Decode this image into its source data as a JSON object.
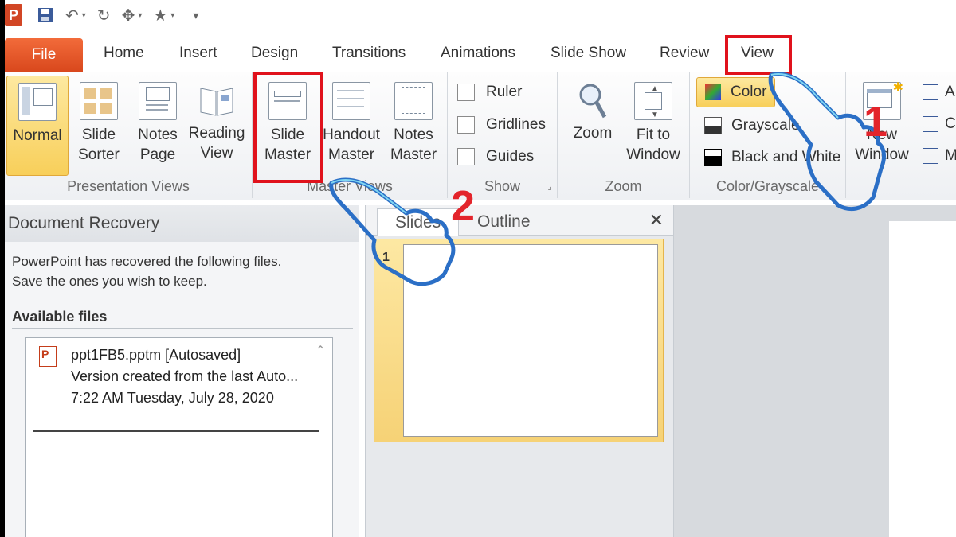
{
  "quick_access": {
    "app_logo": "P",
    "icons": [
      "save-icon",
      "undo-icon",
      "redo-icon",
      "format-painter-icon",
      "star-icon",
      "customize-icon"
    ]
  },
  "tabs": {
    "file": "File",
    "items": [
      "Home",
      "Insert",
      "Design",
      "Transitions",
      "Animations",
      "Slide Show",
      "Review",
      "View"
    ]
  },
  "ribbon": {
    "presentation_views": {
      "label": "Presentation Views",
      "buttons": [
        {
          "line1": "Normal",
          "line2": ""
        },
        {
          "line1": "Slide",
          "line2": "Sorter"
        },
        {
          "line1": "Notes",
          "line2": "Page"
        },
        {
          "line1": "Reading",
          "line2": "View"
        }
      ]
    },
    "master_views": {
      "label": "Master Views",
      "buttons": [
        {
          "line1": "Slide",
          "line2": "Master"
        },
        {
          "line1": "Handout",
          "line2": "Master"
        },
        {
          "line1": "Notes",
          "line2": "Master"
        }
      ]
    },
    "show": {
      "label": "Show",
      "items": [
        "Ruler",
        "Gridlines",
        "Guides"
      ]
    },
    "zoom": {
      "label": "Zoom",
      "zoom": "Zoom",
      "fit_line1": "Fit to",
      "fit_line2": "Window"
    },
    "color": {
      "label": "Color/Grayscale",
      "items": [
        "Color",
        "Grayscale",
        "Black and White"
      ]
    },
    "window": {
      "new_line1": "New",
      "new_line2": "Window",
      "partial": [
        "A",
        "C",
        "M"
      ]
    }
  },
  "recovery": {
    "title": "Document Recovery",
    "message_line1": "PowerPoint has recovered the following files.",
    "message_line2": "Save the ones you wish to keep.",
    "available": "Available files",
    "file": {
      "name": "ppt1FB5.pptm  [Autosaved]",
      "desc": "Version created from the last Auto...",
      "time": "7:22 AM Tuesday, July 28, 2020"
    }
  },
  "slides_pane": {
    "tab_slides": "Slides",
    "tab_outline": "Outline",
    "slide_number": "1"
  },
  "annotations": {
    "step1": "1",
    "step2": "2",
    "highlight_color": "#e0121c"
  }
}
